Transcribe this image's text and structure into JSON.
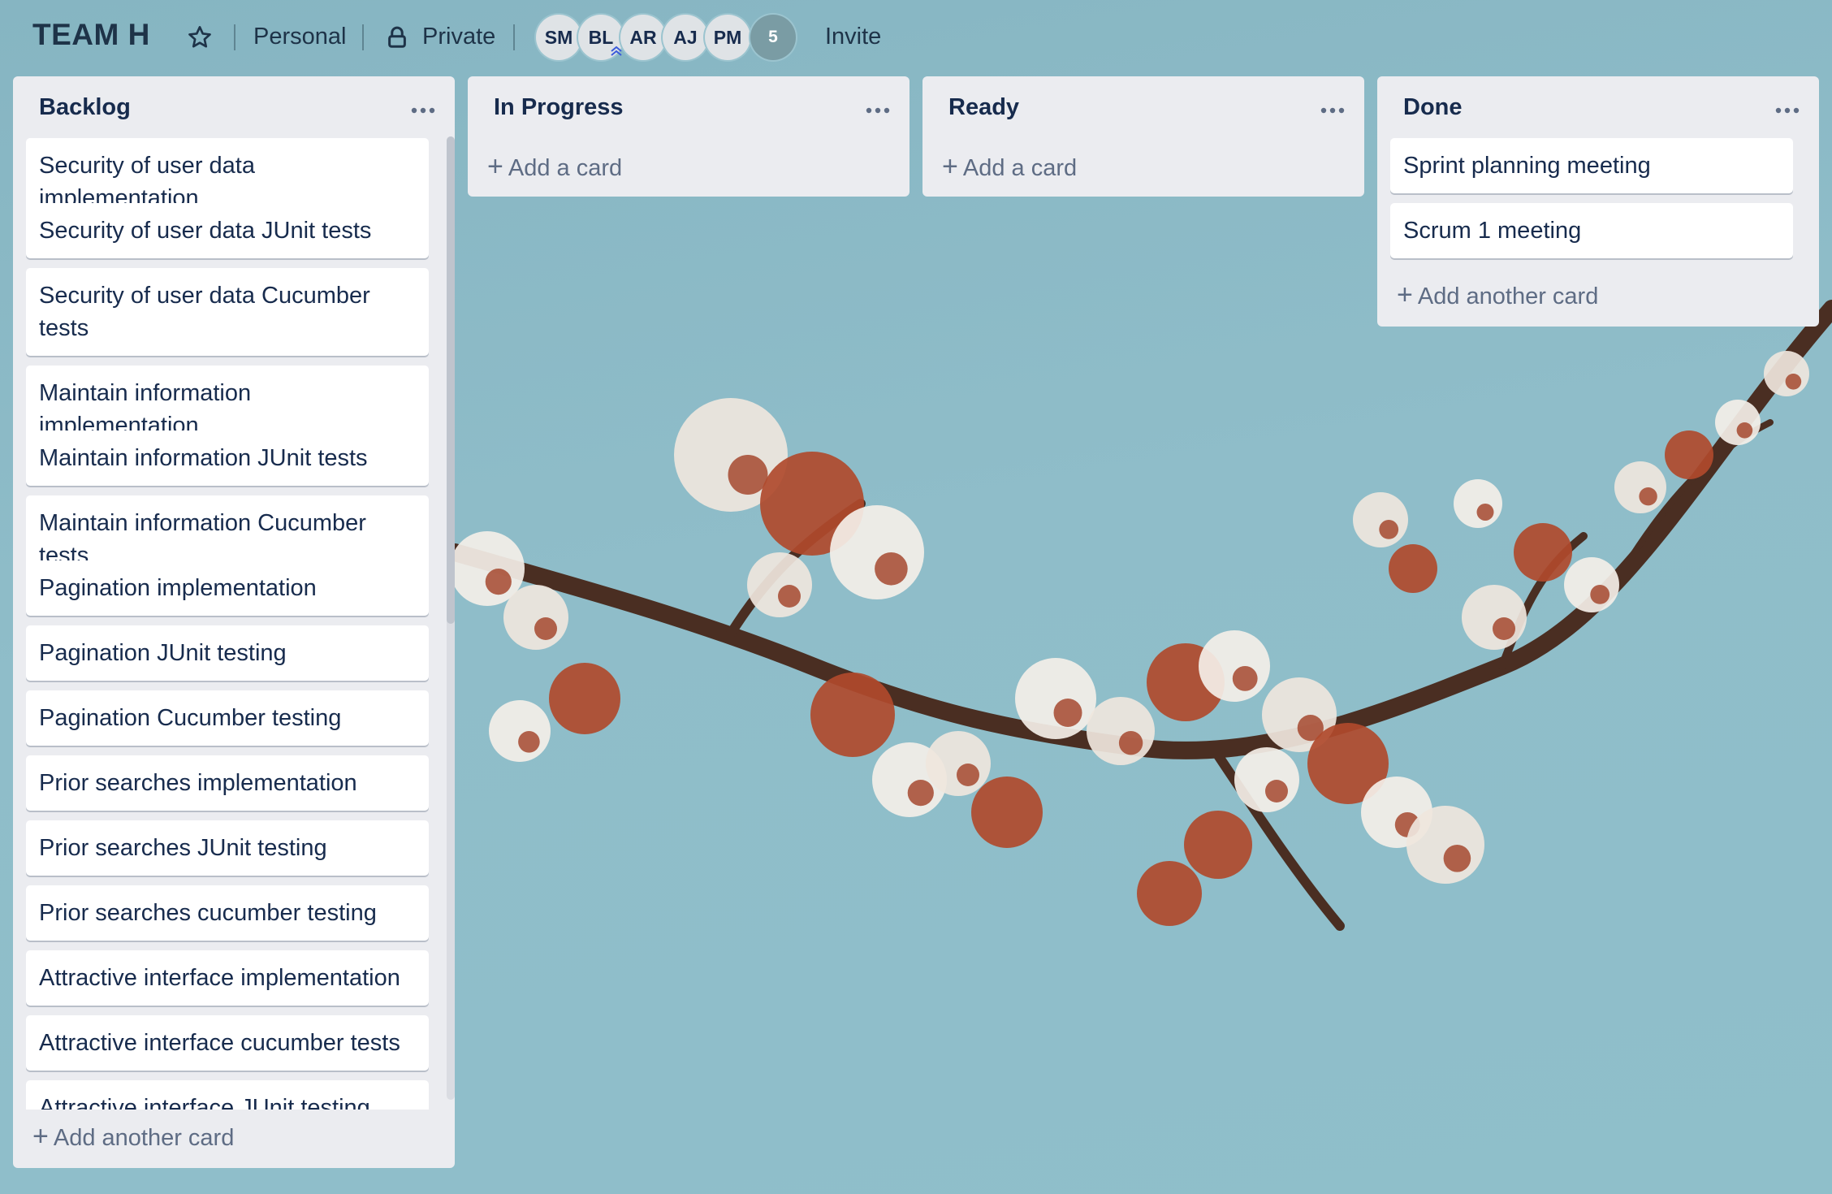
{
  "board": {
    "title": "TEAM H",
    "team_label": "Personal",
    "visibility": "Private",
    "invite_label": "Invite",
    "members": [
      "SM",
      "BL",
      "AR",
      "AJ",
      "PM"
    ],
    "more_members": "5"
  },
  "lists": [
    {
      "title": "Backlog",
      "cards": [
        "Security of user data implementation",
        "Security of user data JUnit tests",
        "Security of user data Cucumber tests",
        "Maintain information implementation",
        "Maintain information JUnit tests",
        "Maintain information Cucumber tests",
        "Pagination implementation",
        "Pagination JUnit testing",
        "Pagination Cucumber testing",
        "Prior searches implementation",
        "Prior searches JUnit testing",
        "Prior searches cucumber testing",
        "Attractive interface implementation",
        "Attractive interface cucumber tests",
        "Attractive interface JUnit testing"
      ],
      "add_label": "Add another card"
    },
    {
      "title": "In Progress",
      "cards": [],
      "add_label": "Add a card"
    },
    {
      "title": "Ready",
      "cards": [],
      "add_label": "Add a card"
    },
    {
      "title": "Done",
      "cards": [
        "Sprint planning meeting",
        "Scrum 1 meeting"
      ],
      "add_label": "Add another card"
    }
  ],
  "colors": {
    "background": "#8fbdc9",
    "list": "#ebecf0",
    "card": "#ffffff",
    "text": "#172b4d"
  },
  "icons": [
    "star-icon",
    "lock-icon",
    "menu-dots-icon",
    "plus-icon"
  ]
}
